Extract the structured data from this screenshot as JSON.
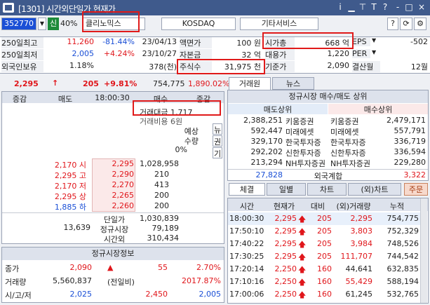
{
  "window": {
    "title": "[1301] 시간외단일가 현재가",
    "buttons": [
      "i",
      "▁",
      "⊤",
      "T",
      "?",
      "‐",
      "□",
      "×"
    ]
  },
  "toolbar": {
    "code": "352770",
    "market_badge": "신",
    "margin": "40%",
    "stock_name": "클리노믹스",
    "market": "KOSDAQ",
    "other_service": "기타서비스",
    "help": "?"
  },
  "info_rows": [
    {
      "c1_label": "250일최고",
      "c1_val": "11,260",
      "c1_pct": "-81.44%",
      "c1_date": "23/04/13",
      "c2_label": "액면가",
      "c2_val": "100 원",
      "c3_label": "시가총",
      "c3_val": "668 억",
      "c4_label": "EPS",
      "c4_val": "-502"
    },
    {
      "c1_label": "250일최저",
      "c1_val": "2,005",
      "c1_pct": "+4.24%",
      "c1_date": "23/10/27",
      "c2_label": "자본금",
      "c2_val": "32 억",
      "c3_label": "대용가",
      "c3_val": "1,220",
      "c4_label": "PER",
      "c4_val": ""
    },
    {
      "c1_label": "외국인보유",
      "c1_val": "1.18%",
      "c1_pct": "",
      "c1_date": "378(천)",
      "c2_label": "주식수",
      "c2_val": "31,975 천",
      "c3_label": "기준가",
      "c3_val": "2,090",
      "c4_label": "결산월",
      "c4_val": "12월"
    }
  ],
  "price_bar": {
    "price": "2,295",
    "arrow": "↑",
    "change": "205",
    "pct": "+9.81%",
    "volume": "754,775",
    "amount": "1,890.02%"
  },
  "orderbook": {
    "headers": [
      "증감",
      "매도",
      "18:00:30",
      "매수",
      "증감"
    ],
    "trade_amount": "거래대금 1,717",
    "trade_cost": "거래비용 6원",
    "expected_label": "예상",
    "expected_qty_label": "수량",
    "expected_pct": "0%",
    "side_tabs": [
      "뉴",
      "권",
      "기"
    ],
    "asks": [
      {
        "tag": "2,170 시",
        "price": "2,295",
        "qty": "1,028,958"
      },
      {
        "tag": "2,295 고",
        "price": "2,290",
        "qty": "210"
      },
      {
        "tag": "2,170 저",
        "price": "2,270",
        "qty": "413"
      },
      {
        "tag": "2,295 상",
        "price": "2,265",
        "qty": "200"
      },
      {
        "tag": "1,885 하",
        "price": "2,260",
        "qty": "200"
      }
    ],
    "summary_left": "13,639",
    "summary_labels": [
      "단일가",
      "정규시장",
      "시간외"
    ],
    "summary_vals": [
      "1,030,839",
      "79,189",
      "310,434"
    ]
  },
  "regular": {
    "title": "정규시장정보",
    "rows": [
      {
        "label": "종가",
        "v1": "2,090",
        "v2": "▲",
        "v3": "55",
        "v4": "2.70%"
      },
      {
        "label": "거래량",
        "v1": "5,560,837",
        "v2": "(전일비)",
        "v3": "",
        "v4": "2017.87%"
      },
      {
        "label": "시/고/저",
        "v1": "2,025",
        "v2": "",
        "v3": "2,450",
        "v4": "2,005"
      }
    ]
  },
  "right_tabs": [
    "거래원",
    "뉴스"
  ],
  "broker": {
    "title": "정규시장 매수/매도 상위",
    "sell_header": "매도상위",
    "buy_header": "매수상위",
    "rows": [
      {
        "sv": "2,388,251",
        "sn": "키움증권",
        "bn": "키움증권",
        "bv": "2,479,171"
      },
      {
        "sv": "592,447",
        "sn": "미래에셋",
        "bn": "미래에셋",
        "bv": "557,791"
      },
      {
        "sv": "329,170",
        "sn": "한국투자증",
        "bn": "한국투자증",
        "bv": "336,719"
      },
      {
        "sv": "292,202",
        "sn": "신한투자증",
        "bn": "신한투자증",
        "bv": "336,594"
      },
      {
        "sv": "213,294",
        "sn": "NH투자증권",
        "bn": "NH투자증권",
        "bv": "229,280"
      }
    ],
    "foreign_sell": "27,828",
    "foreign_label": "외국계합",
    "foreign_buy": "3,322"
  },
  "trade_tabs": [
    "체결",
    "일별",
    "차트",
    "(외)차트",
    "주문"
  ],
  "trades": {
    "headers": [
      "시간",
      "현재가",
      "대비",
      "(외)거래량",
      "누적"
    ],
    "rows": [
      {
        "t": "18:00:30",
        "p": "2,295",
        "d": "205",
        "v": "2,295",
        "c": "754,775"
      },
      {
        "t": "17:50:10",
        "p": "2,295",
        "d": "205",
        "v": "3,803",
        "c": "752,329"
      },
      {
        "t": "17:40:22",
        "p": "2,295",
        "d": "205",
        "v": "3,984",
        "c": "748,526"
      },
      {
        "t": "17:30:25",
        "p": "2,295",
        "d": "205",
        "v": "111,707",
        "c": "744,542"
      },
      {
        "t": "17:20:14",
        "p": "2,250",
        "d": "160",
        "v": "44,641",
        "c": "632,835"
      },
      {
        "t": "17:10:16",
        "p": "2,250",
        "d": "160",
        "v": "55,429",
        "c": "588,194"
      },
      {
        "t": "17:00:06",
        "p": "2,250",
        "d": "160",
        "v": "61,245",
        "c": "532,765"
      }
    ]
  }
}
